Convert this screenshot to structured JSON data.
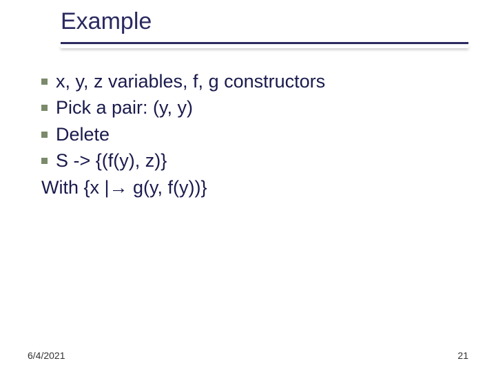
{
  "title": "Example",
  "bullets": [
    "x, y, z variables, f, g constructors",
    "Pick a pair: (y, y)",
    "Delete",
    "S -> {(f(y), z)}"
  ],
  "closing": "With {x |→ g(y, f(y))}",
  "footer": {
    "date": "6/4/2021",
    "page": "21"
  }
}
